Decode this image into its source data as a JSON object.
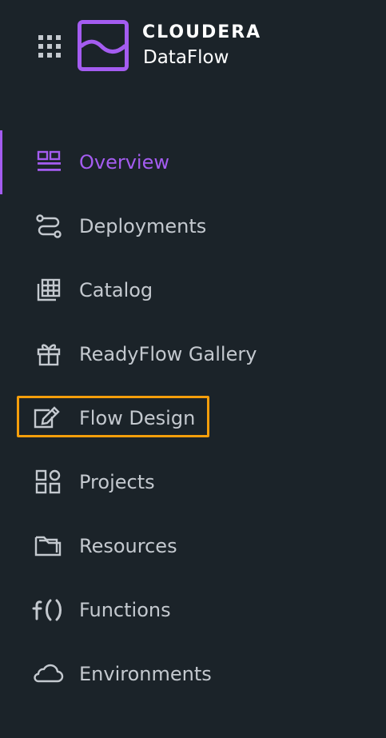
{
  "brand": {
    "name": "CLOUDERA",
    "product": "DataFlow"
  },
  "icons": {
    "app_switcher": "grid-icon",
    "logo": "dataflow-logo-icon"
  },
  "colors": {
    "background": "#1b2329",
    "active": "#a45cf0",
    "text": "#c4c9cf",
    "highlight": "#f59e0b"
  },
  "nav": {
    "items": [
      {
        "label": "Overview",
        "icon": "overview-icon",
        "active": true
      },
      {
        "label": "Deployments",
        "icon": "deployments-icon"
      },
      {
        "label": "Catalog",
        "icon": "catalog-icon"
      },
      {
        "label": "ReadyFlow Gallery",
        "icon": "gift-icon"
      },
      {
        "label": "Flow Design",
        "icon": "edit-icon",
        "highlighted": true
      },
      {
        "label": "Projects",
        "icon": "projects-icon"
      },
      {
        "label": "Resources",
        "icon": "folder-icon"
      },
      {
        "label": "Functions",
        "icon": "function-icon"
      },
      {
        "label": "Environments",
        "icon": "cloud-icon"
      }
    ]
  }
}
